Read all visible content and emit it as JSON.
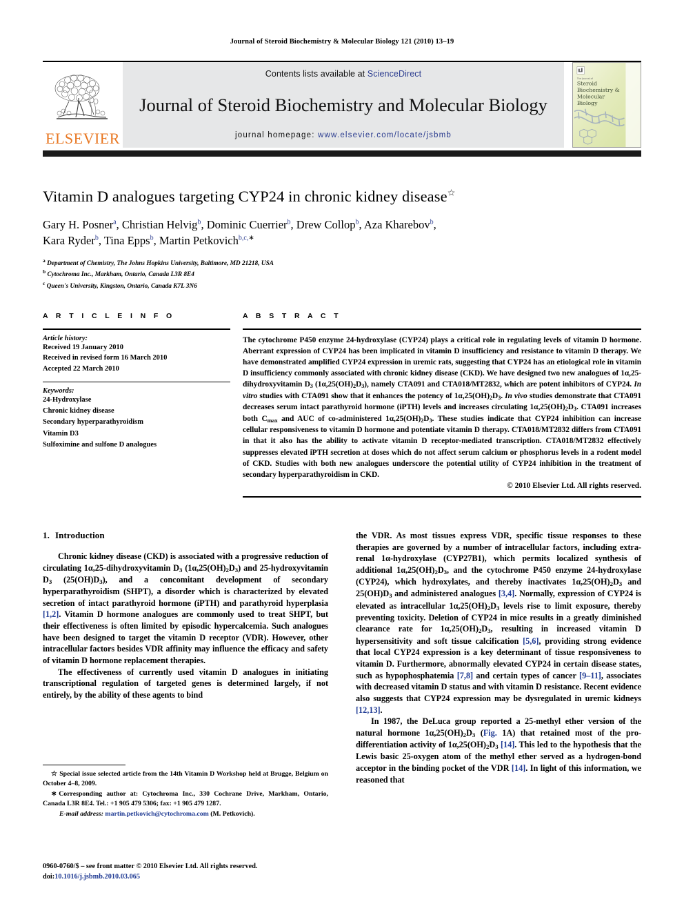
{
  "running_head": "Journal of Steroid Biochemistry & Molecular Biology 121 (2010) 13–19",
  "masthead": {
    "contents_prefix": "Contents lists available at ",
    "sciencedirect": "ScienceDirect",
    "journal_title": "Journal of Steroid Biochemistry and Molecular Biology",
    "homepage_prefix": "journal homepage: ",
    "homepage_url": "www.elsevier.com/locate/jsbmb",
    "publisher_wordmark": "ELSEVIER",
    "cover_lines": [
      "The Journal of",
      "Steroid",
      "Biochemistry &",
      "Molecular",
      "Biology"
    ],
    "accent_link_color": "#2b3c8f",
    "elsevier_orange": "#E87722",
    "band_gray": "#e6e7e8"
  },
  "article": {
    "title": "Vitamin D analogues targeting CYP24 in chronic kidney disease",
    "title_footnote_mark": "☆",
    "authors_html": "Gary H. Posner<sup>a</sup>, Christian Helvig<sup>b</sup>, Dominic Cuerrier<sup>b</sup>, Drew Collop<sup>b</sup>, Aza Kharebov<sup>b</>, Kara Ryder<sup>b</sup>, Tina Epps<sup>b</sup>, Martin Petkovich<sup>b,c,</sup>",
    "authors_line1": "Gary H. Posner",
    "affiliations": [
      {
        "mark": "a",
        "text": "Department of Chemistry, The Johns Hopkins University, Baltimore, MD 21218, USA"
      },
      {
        "mark": "b",
        "text": "Cytochroma Inc., Markham, Ontario, Canada L3R 8E4"
      },
      {
        "mark": "c",
        "text": "Queen's University, Kingston, Ontario, Canada K7L 3N6"
      }
    ]
  },
  "article_info": {
    "heading": "A R T I C L E    I N F O",
    "history_label": "Article history:",
    "history": [
      "Received 19 January 2010",
      "Received in revised form 16 March 2010",
      "Accepted 22 March 2010"
    ],
    "keywords_label": "Keywords:",
    "keywords": [
      "24-Hydroxylase",
      "Chronic kidney disease",
      "Secondary hyperparathyroidism",
      "Vitamin D3",
      "Sulfoximine and sulfone D analogues"
    ]
  },
  "abstract": {
    "heading": "A B S T R A C T",
    "copyright": "© 2010 Elsevier Ltd. All rights reserved."
  },
  "sections": {
    "introduction_number": "1.",
    "introduction_title": "Introduction"
  },
  "footnotes": {
    "special_issue_mark": "☆",
    "special_issue": "Special issue selected article from the 14th Vitamin D Workshop held at Brugge, Belgium on October 4–8, 2009.",
    "corresponding_mark": "∗",
    "corresponding": "Corresponding author at: Cytochroma Inc., 330 Cochrane Drive, Markham, Ontario, Canada L3R 8E4. Tel.: +1 905 479 5306; fax: +1 905 479 1287.",
    "email_label": "E-mail address:",
    "email": "martin.petkovich@cytochroma.com",
    "email_suffix": "(M. Petkovich).",
    "issn_line": "0960-0760/$ – see front matter © 2010 Elsevier Ltd. All rights reserved.",
    "doi_label": "doi:",
    "doi": "10.1016/j.jsbmb.2010.03.065"
  }
}
